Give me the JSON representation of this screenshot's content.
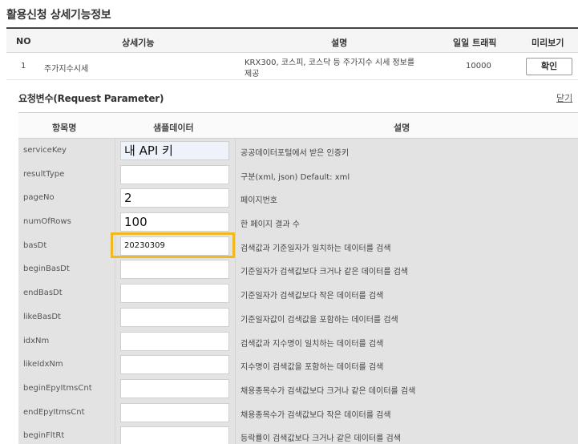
{
  "page_title": "활용신청 상세기능정보",
  "top_table": {
    "headers": [
      "NO",
      "상세기능",
      "설명",
      "일일 트래픽",
      "미리보기"
    ],
    "row": {
      "no": "1",
      "function": "주가지수시세",
      "description_line1": "KRX300, 코스피, 코스닥 등 주가지수 시세 정보를",
      "description_line2": "제공",
      "traffic": "10000",
      "button": "확인"
    }
  },
  "request": {
    "title": "요청변수(Request Parameter)",
    "close": "닫기",
    "headers": [
      "항목명",
      "샘플데이터",
      "설명"
    ],
    "rows": [
      {
        "name": "serviceKey",
        "value": "내 API 키",
        "desc": "공공데이터포털에서 받은 인증키"
      },
      {
        "name": "resultType",
        "value": "",
        "desc": "구분(xml, json) Default: xml"
      },
      {
        "name": "pageNo",
        "value": "2",
        "desc": "페이지번호"
      },
      {
        "name": "numOfRows",
        "value": "100",
        "desc": "한 페이지 결과 수"
      },
      {
        "name": "basDt",
        "value": "20230309",
        "desc": "검색값과 기준일자가 일치하는 데이터를 검색"
      },
      {
        "name": "beginBasDt",
        "value": "",
        "desc": "기준일자가 검색값보다 크거나 같은 데이터를 검색"
      },
      {
        "name": "endBasDt",
        "value": "",
        "desc": "기준일자가 검색값보다 작은 데이터를 검색"
      },
      {
        "name": "likeBasDt",
        "value": "",
        "desc": "기준일자값이 검색값을 포함하는 데이터를 검색"
      },
      {
        "name": "idxNm",
        "value": "",
        "desc": "검색값과 지수명이 일치하는 데이터를 검색"
      },
      {
        "name": "likeIdxNm",
        "value": "",
        "desc": "지수명이 검색값을 포함하는 데이터를 검색"
      },
      {
        "name": "beginEpyItmsCnt",
        "value": "",
        "desc": "채용종목수가 검색값보다 크거나 같은 데이터를 검색"
      },
      {
        "name": "endEpyItmsCnt",
        "value": "",
        "desc": "채용종목수가 검색값보다 작은 데이터를 검색"
      },
      {
        "name": "beginFltRt",
        "value": "",
        "desc": "등락률이 검색값보다 크거나 같은 데이터를 검색"
      }
    ]
  },
  "highlight_color": "#f2b91e"
}
